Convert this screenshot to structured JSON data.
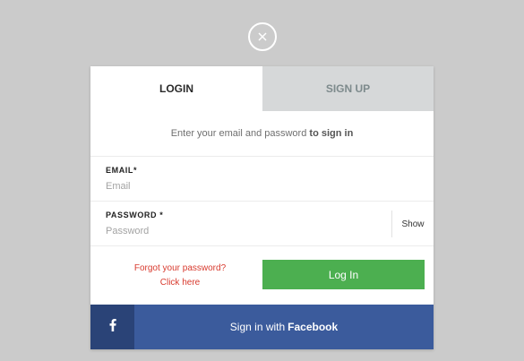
{
  "close": {
    "icon": "close-icon"
  },
  "tabs": {
    "login": "LOGIN",
    "signup": "SIGN UP"
  },
  "subtitle": {
    "prefix": "Enter your email and password",
    "suffix": "to sign in"
  },
  "email": {
    "label": "EMAIL*",
    "placeholder": "Email"
  },
  "password": {
    "label": "PASSWORD *",
    "placeholder": "Password",
    "show": "Show"
  },
  "forgot": {
    "line1": "Forgot your password?",
    "line2": "Click here"
  },
  "login_button": "Log In",
  "facebook": {
    "icon": "facebook-icon",
    "prefix": "Sign in with",
    "brand": "Facebook"
  },
  "colors": {
    "background": "#cbcbcb",
    "login_green": "#4caf50",
    "facebook_blue": "#3b5b9c",
    "facebook_dark": "#2a4377",
    "link_red": "#d83a2e",
    "inactive_tab": "#d6d8d9"
  }
}
